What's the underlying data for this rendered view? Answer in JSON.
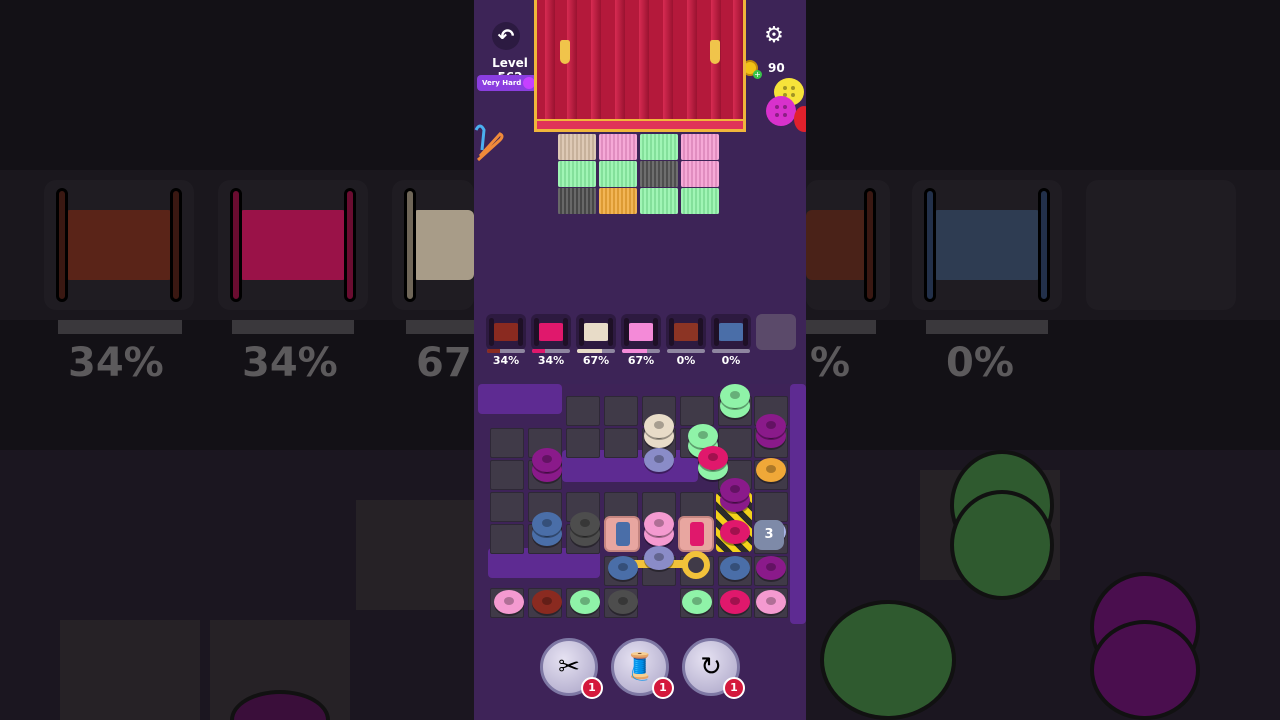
{
  "header": {
    "undo_icon": "undo-icon",
    "level_label": "Level 562",
    "difficulty_label": "Very Hard",
    "settings_icon": "gear-icon",
    "coin_count": "90"
  },
  "colors": {
    "phone_background": "#3c2458",
    "curtain": "#b4193b",
    "curtain_trim": "#f0b63b",
    "wall": "#5e2b92",
    "tile": "#403a48"
  },
  "cloth": {
    "rows": [
      [
        "#d8c0a8",
        "#f49ad0",
        "#8ff3a8",
        "#f49ad0"
      ],
      [
        "#8ff3a8",
        "#8ff3a8",
        "#555555",
        "#f49ad0"
      ],
      [
        "#4d4d4d",
        "#f0a838",
        "#8ff3a8",
        "#8ff3a8"
      ]
    ]
  },
  "spools": [
    {
      "name": "spool-dark-red",
      "color": "#8a2a20",
      "percent_text": "34%",
      "progress": 0.34
    },
    {
      "name": "spool-magenta",
      "color": "#e0186c",
      "percent_text": "34%",
      "progress": 0.34
    },
    {
      "name": "spool-cream",
      "color": "#e8dcc8",
      "percent_text": "67%",
      "progress": 0.67
    },
    {
      "name": "spool-pink",
      "color": "#f48ad8",
      "percent_text": "67%",
      "progress": 0.67
    },
    {
      "name": "spool-rust",
      "color": "#8c3424",
      "percent_text": "0%",
      "progress": 0
    },
    {
      "name": "spool-steel-blue",
      "color": "#4a6ea8",
      "percent_text": "0%",
      "progress": 0
    }
  ],
  "board": {
    "counter_value": "3"
  },
  "boosters": [
    {
      "name": "scissors-booster",
      "icon": "scissors-icon",
      "count": "1"
    },
    {
      "name": "spool-booster",
      "icon": "spool-icon",
      "count": "1"
    },
    {
      "name": "shuffle-booster",
      "icon": "shuffle-icon",
      "count": "1"
    }
  ],
  "backdrop": {
    "left_pct_1": "34%",
    "left_pct_2": "34%",
    "left_pct_3": "67",
    "right_pct_1": "%",
    "right_pct_2": "0%"
  }
}
